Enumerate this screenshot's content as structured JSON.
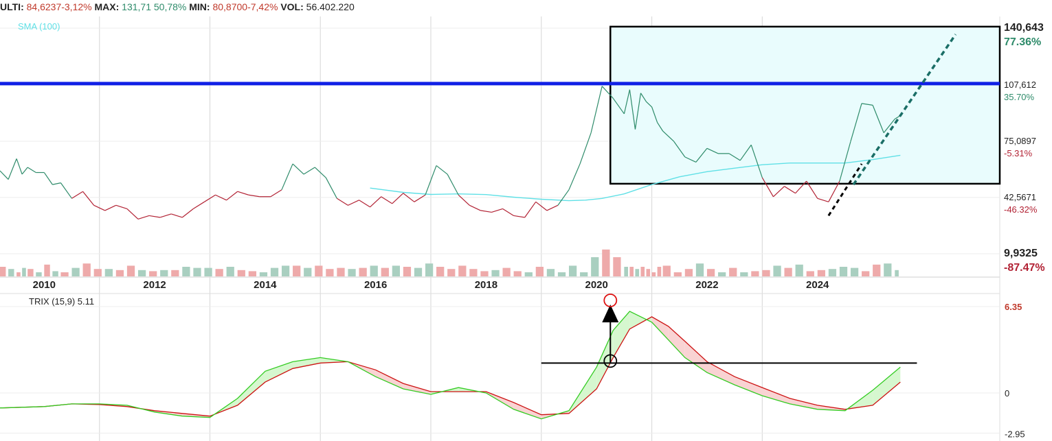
{
  "header": {
    "last_label": "ULTI:",
    "last_value": "84,6237",
    "last_change": "-3,12%",
    "max_label": "MAX:",
    "max_value": "131,71",
    "max_change": "50,78%",
    "min_label": "MIN:",
    "min_value": "80,8700",
    "min_change": "-7,42%",
    "vol_label": "VOL:",
    "vol_value": "56.402.220"
  },
  "colors": {
    "price_up": "#2e8b6a",
    "price_down": "#b22234",
    "sma": "#5fe0e6",
    "blue_line": "#1020e6",
    "box_fill": "#e9fcfd",
    "trix_green": "#33cc22",
    "trix_red": "#cc1111",
    "vol_up": "#a9cfc0",
    "vol_down": "#eeaaaa"
  },
  "chart_data": [
    {
      "type": "line",
      "title": "",
      "legend": [
        "SMA (100)"
      ],
      "xlim": [
        2009.2,
        2027.3
      ],
      "x_ticks": [
        {
          "x": 2010,
          "label": "2010"
        },
        {
          "x": 2012,
          "label": "2012"
        },
        {
          "x": 2014,
          "label": "2014"
        },
        {
          "x": 2016,
          "label": "2016"
        },
        {
          "x": 2018,
          "label": "2018"
        },
        {
          "x": 2020,
          "label": "2020"
        },
        {
          "x": 2022,
          "label": "2022"
        },
        {
          "x": 2024,
          "label": "2024"
        }
      ],
      "y_ticks": [
        {
          "value": 140.643,
          "label": "140,643",
          "pct": "77.36%",
          "pct_color": "up",
          "bold": true
        },
        {
          "value": 107.612,
          "label": "107,612",
          "pct": "35.70%",
          "pct_color": "up",
          "bold": false
        },
        {
          "value": 75.0897,
          "label": "75,0897",
          "pct": "-5.31%",
          "pct_color": "down",
          "bold": false
        },
        {
          "value": 42.5671,
          "label": "42,5671",
          "pct": "-46.32%",
          "pct_color": "down",
          "bold": false
        },
        {
          "value": 9.9325,
          "label": "9,9325",
          "pct": "-87.47%",
          "pct_color": "down",
          "bold": true
        }
      ],
      "horizontal_line": 108.5,
      "rectangle": {
        "x": [
          2020.25,
          2027.3
        ],
        "y": [
          50.5,
          141.5
        ]
      },
      "trend_black": {
        "x": [
          2024.2,
          2024.8
        ],
        "y": [
          32,
          62
        ]
      },
      "trend_green": {
        "x": [
          2024.65,
          2026.5
        ],
        "y": [
          50,
          137
        ]
      },
      "series": [
        {
          "name": "SMA (100)",
          "x": [
            2015.9,
            2016.5,
            2017.0,
            2017.5,
            2018.0,
            2018.5,
            2019.0,
            2019.5,
            2019.8,
            2020.1,
            2020.5,
            2021.0,
            2021.5,
            2022.0,
            2022.5,
            2023.0,
            2023.5,
            2024.0,
            2024.5,
            2025.0,
            2025.5
          ],
          "y": [
            48,
            45.5,
            44.3,
            44.6,
            44.2,
            42.7,
            41.5,
            40.7,
            41,
            42,
            44.6,
            50,
            54.5,
            57.5,
            59.5,
            61.5,
            62.5,
            62.5,
            62.5,
            64.5,
            67
          ]
        },
        {
          "name": "",
          "x": [
            2009.2,
            2009.35,
            2009.5,
            2009.6,
            2009.7,
            2009.85,
            2010.0,
            2010.15,
            2010.3,
            2010.5,
            2010.7,
            2010.9,
            2011.1,
            2011.3,
            2011.5,
            2011.7,
            2011.9,
            2012.1,
            2012.3,
            2012.5,
            2012.7,
            2012.9,
            2013.1,
            2013.3,
            2013.5,
            2013.7,
            2013.9,
            2014.1,
            2014.3,
            2014.5,
            2014.7,
            2014.9,
            2015.1,
            2015.3,
            2015.5,
            2015.7,
            2015.9,
            2016.1,
            2016.3,
            2016.5,
            2016.7,
            2016.9,
            2017.1,
            2017.3,
            2017.5,
            2017.7,
            2017.9,
            2018.1,
            2018.3,
            2018.5,
            2018.7,
            2018.9,
            2019.1,
            2019.3,
            2019.5,
            2019.7,
            2019.9,
            2020.1,
            2020.3,
            2020.5,
            2020.6,
            2020.7,
            2020.8,
            2020.9,
            2021.0,
            2021.1,
            2021.2,
            2021.4,
            2021.6,
            2021.8,
            2022.0,
            2022.2,
            2022.4,
            2022.6,
            2022.8,
            2023.0,
            2023.2,
            2023.4,
            2023.6,
            2023.8,
            2024.0,
            2024.2,
            2024.4,
            2024.6,
            2024.8,
            2025.0,
            2025.2,
            2025.4,
            2025.5
          ],
          "y": [
            58,
            53,
            65,
            56,
            60,
            57,
            57,
            50,
            51,
            42,
            46,
            38,
            35,
            38,
            36,
            30,
            32,
            31,
            33,
            31,
            36,
            40,
            44,
            41,
            46,
            44,
            43,
            43,
            47,
            62,
            56,
            60,
            54,
            42,
            38,
            41,
            37,
            43,
            39,
            45,
            40,
            44,
            61,
            56,
            44,
            38,
            35,
            34,
            36,
            32,
            31,
            40,
            35,
            38,
            47,
            62,
            80,
            107,
            100,
            91,
            105,
            82,
            103,
            98,
            95,
            86,
            81,
            75,
            66,
            63,
            71,
            68,
            68,
            64,
            73,
            54,
            43,
            49,
            45,
            52,
            42,
            40,
            52,
            75,
            97,
            96,
            80,
            88,
            90
          ]
        }
      ]
    },
    {
      "type": "line",
      "title": "TRIX (15,9) 5.11",
      "legend": [
        "TRIX (15,9) 5.11"
      ],
      "y_ticks": [
        {
          "value": 6.35,
          "label": "6.35"
        },
        {
          "value": 0,
          "label": "0"
        },
        {
          "value": -2.95,
          "label": "-2.95"
        }
      ],
      "horizontal_line": 2.2,
      "series": [
        {
          "name": "TRIX",
          "x": [
            2009.2,
            2010.0,
            2010.5,
            2011.0,
            2011.5,
            2012.0,
            2012.5,
            2013.0,
            2013.5,
            2014.0,
            2014.5,
            2015.0,
            2015.5,
            2016.0,
            2016.5,
            2017.0,
            2017.5,
            2018.0,
            2018.5,
            2019.0,
            2019.5,
            2020.0,
            2020.3,
            2020.6,
            2021.0,
            2021.3,
            2021.6,
            2022.0,
            2022.5,
            2023.0,
            2023.5,
            2024.0,
            2024.5,
            2025.0,
            2025.5
          ],
          "y": [
            -1.1,
            -1.0,
            -0.8,
            -0.8,
            -0.9,
            -1.4,
            -1.7,
            -1.8,
            -0.4,
            1.6,
            2.3,
            2.6,
            2.3,
            1.2,
            0.3,
            -0.1,
            0.4,
            0.0,
            -1.2,
            -1.9,
            -1.3,
            1.9,
            4.6,
            6.0,
            5.2,
            3.9,
            2.6,
            1.5,
            0.6,
            -0.2,
            -0.8,
            -1.2,
            -1.3,
            0.2,
            1.9
          ]
        },
        {
          "name": "Signal",
          "x": [
            2009.2,
            2010.0,
            2010.5,
            2011.0,
            2011.5,
            2012.0,
            2012.5,
            2013.0,
            2013.5,
            2014.0,
            2014.5,
            2015.0,
            2015.5,
            2016.0,
            2016.5,
            2017.0,
            2017.5,
            2018.0,
            2018.5,
            2019.0,
            2019.5,
            2020.0,
            2020.3,
            2020.6,
            2021.0,
            2021.3,
            2021.6,
            2022.0,
            2022.5,
            2023.0,
            2023.5,
            2024.0,
            2024.5,
            2025.0,
            2025.5
          ],
          "y": [
            -1.1,
            -1.0,
            -0.8,
            -0.85,
            -1.0,
            -1.3,
            -1.5,
            -1.7,
            -0.9,
            0.8,
            1.8,
            2.2,
            2.3,
            1.7,
            0.7,
            0.1,
            0.1,
            0.1,
            -0.7,
            -1.6,
            -1.5,
            0.3,
            2.6,
            4.7,
            5.6,
            4.9,
            3.8,
            2.3,
            1.2,
            0.4,
            -0.4,
            -0.9,
            -1.2,
            -0.9,
            0.8
          ]
        }
      ]
    }
  ]
}
